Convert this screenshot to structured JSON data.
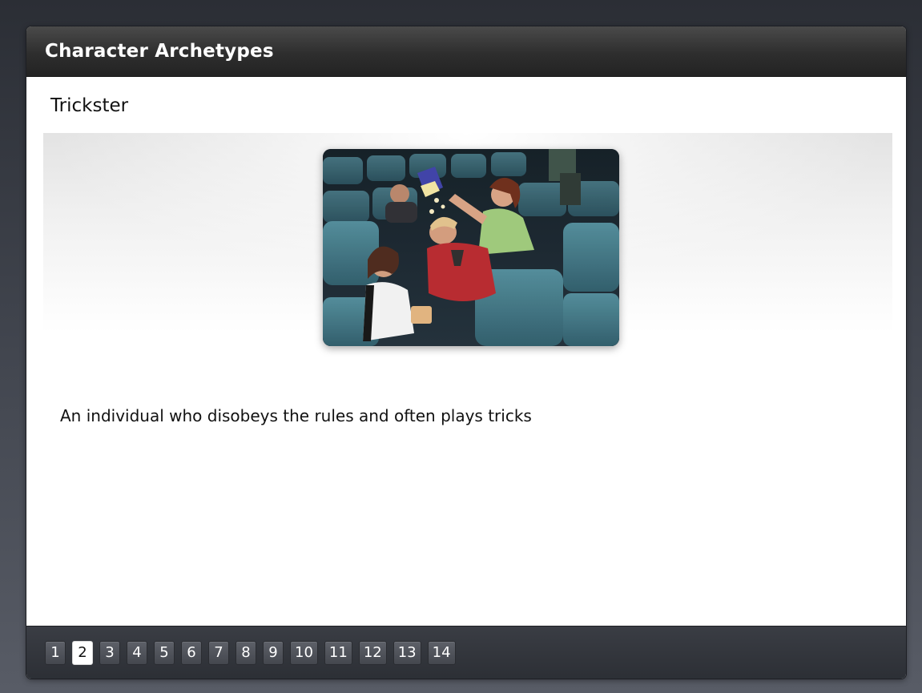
{
  "app": {
    "title": "Character Archetypes"
  },
  "slide": {
    "heading": "Trickster",
    "description": "An individual who disobeys the rules and often plays tricks",
    "image_alt": "Woman pouring popcorn on a sleeping man's head in a movie theater"
  },
  "pagination": {
    "current": 2,
    "pages": [
      "1",
      "2",
      "3",
      "4",
      "5",
      "6",
      "7",
      "8",
      "9",
      "10",
      "11",
      "12",
      "13",
      "14"
    ]
  },
  "colors": {
    "title_bar": "#2e2e2e",
    "nav_bar": "#2c2f35",
    "page_button": "#4f525a",
    "page_button_active": "#ffffff"
  }
}
